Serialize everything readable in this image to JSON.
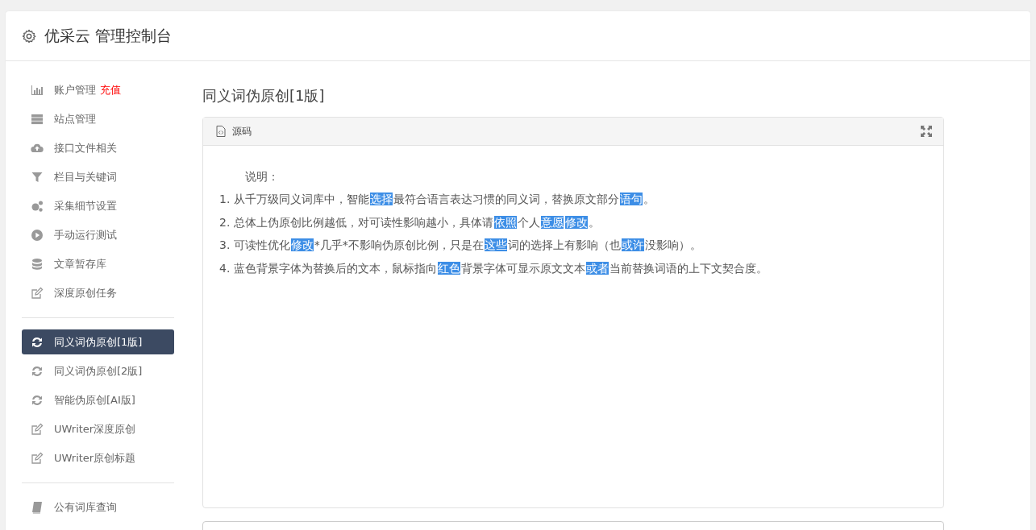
{
  "header": {
    "title": "优采云 管理控制台"
  },
  "sidebar": {
    "groups": [
      {
        "items": [
          {
            "kind": "chart",
            "label": "账户管理",
            "badge": "充值",
            "selected": false
          },
          {
            "kind": "server",
            "label": "站点管理",
            "selected": false
          },
          {
            "kind": "cloud",
            "label": "接口文件相关",
            "selected": false
          },
          {
            "kind": "filter",
            "label": "栏目与关键词",
            "selected": false
          },
          {
            "kind": "cogs",
            "label": "采集细节设置",
            "selected": false
          },
          {
            "kind": "play",
            "label": "手动运行测试",
            "selected": false
          },
          {
            "kind": "database",
            "label": "文章暂存库",
            "selected": false
          },
          {
            "kind": "edit",
            "label": "深度原创任务",
            "selected": false
          }
        ]
      },
      {
        "items": [
          {
            "kind": "refresh",
            "label": "同义词伪原创[1版]",
            "selected": true
          },
          {
            "kind": "refresh",
            "label": "同义词伪原创[2版]",
            "selected": false
          },
          {
            "kind": "refresh",
            "label": "智能伪原创[AI版]",
            "selected": false
          },
          {
            "kind": "edit",
            "label": "UWriter深度原创",
            "selected": false
          },
          {
            "kind": "edit",
            "label": "UWriter原创标题",
            "selected": false
          }
        ]
      },
      {
        "items": [
          {
            "kind": "book",
            "label": "公有词库查询",
            "selected": false
          }
        ]
      }
    ]
  },
  "page": {
    "title": "同义词伪原创[1版]",
    "panel": {
      "title": "源码",
      "heading": "说明：",
      "lines": [
        [
          {
            "text": "1. 从千万级同义词库中，智能",
            "highlight": false
          },
          {
            "text": "选择",
            "highlight": true
          },
          {
            "text": "最符合语言表达习惯的同义词，替换原文部分",
            "highlight": false
          },
          {
            "text": "语句",
            "highlight": true
          },
          {
            "text": "。",
            "highlight": false
          }
        ],
        [
          {
            "text": "2. 总体上伪原创比例越低，对可读性影响越小，具体请",
            "highlight": false
          },
          {
            "text": "依照",
            "highlight": true
          },
          {
            "text": "个人",
            "highlight": false
          },
          {
            "text": "意愿",
            "highlight": true
          },
          {
            "text": "修改",
            "highlight": true
          },
          {
            "text": "。",
            "highlight": false
          }
        ],
        [
          {
            "text": "3. 可读性优化",
            "highlight": false
          },
          {
            "text": "修改",
            "highlight": true
          },
          {
            "text": "*几乎*不影响伪原创比例，只是在",
            "highlight": false
          },
          {
            "text": "这些",
            "highlight": true
          },
          {
            "text": "词的选择上有影响（也",
            "highlight": false
          },
          {
            "text": "或许",
            "highlight": true
          },
          {
            "text": "没影响）。",
            "highlight": false
          }
        ],
        [
          {
            "text": "4. 蓝色背景字体为替换后的文本，鼠标指向",
            "highlight": false
          },
          {
            "text": "红色",
            "highlight": true
          },
          {
            "text": "背景字体可显示原文文本",
            "highlight": false
          },
          {
            "text": "或者",
            "highlight": true
          },
          {
            "text": "当前替换词语的上下文契合度。",
            "highlight": false
          }
        ]
      ]
    }
  }
}
